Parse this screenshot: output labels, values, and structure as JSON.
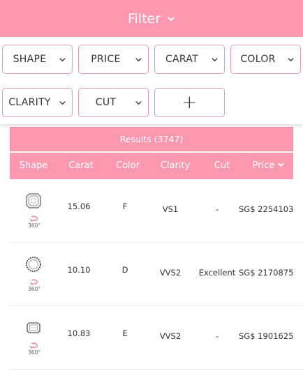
{
  "filter": {
    "title": "Filter"
  },
  "dropdowns": [
    {
      "label": "SHAPE"
    },
    {
      "label": "PRICE"
    },
    {
      "label": "CARAT"
    },
    {
      "label": "COLOR"
    },
    {
      "label": "CLARITY"
    },
    {
      "label": "CUT"
    }
  ],
  "add_button": {
    "label": "+"
  },
  "results": {
    "label": "Results (3747)"
  },
  "table": {
    "headers": [
      "Shape",
      "Carat",
      "Color",
      "Clarity",
      "Cut",
      "Price"
    ],
    "view360_label": "360°",
    "rows": [
      {
        "shape_icon": "asscher-diamond-icon",
        "carat": "15.06",
        "color": "F",
        "clarity": "VS1",
        "cut": "-",
        "price": "SG$ 2254103"
      },
      {
        "shape_icon": "round-diamond-icon",
        "carat": "10.10",
        "color": "D",
        "clarity": "VVS2",
        "cut": "Excellent",
        "price": "SG$ 2170875"
      },
      {
        "shape_icon": "emerald-diamond-icon",
        "carat": "10.83",
        "color": "E",
        "clarity": "VVS2",
        "cut": "-",
        "price": "SG$ 1901625"
      }
    ]
  },
  "colors": {
    "accent": "#fd98b0",
    "border": "#e79ab1",
    "text": "#333333"
  }
}
